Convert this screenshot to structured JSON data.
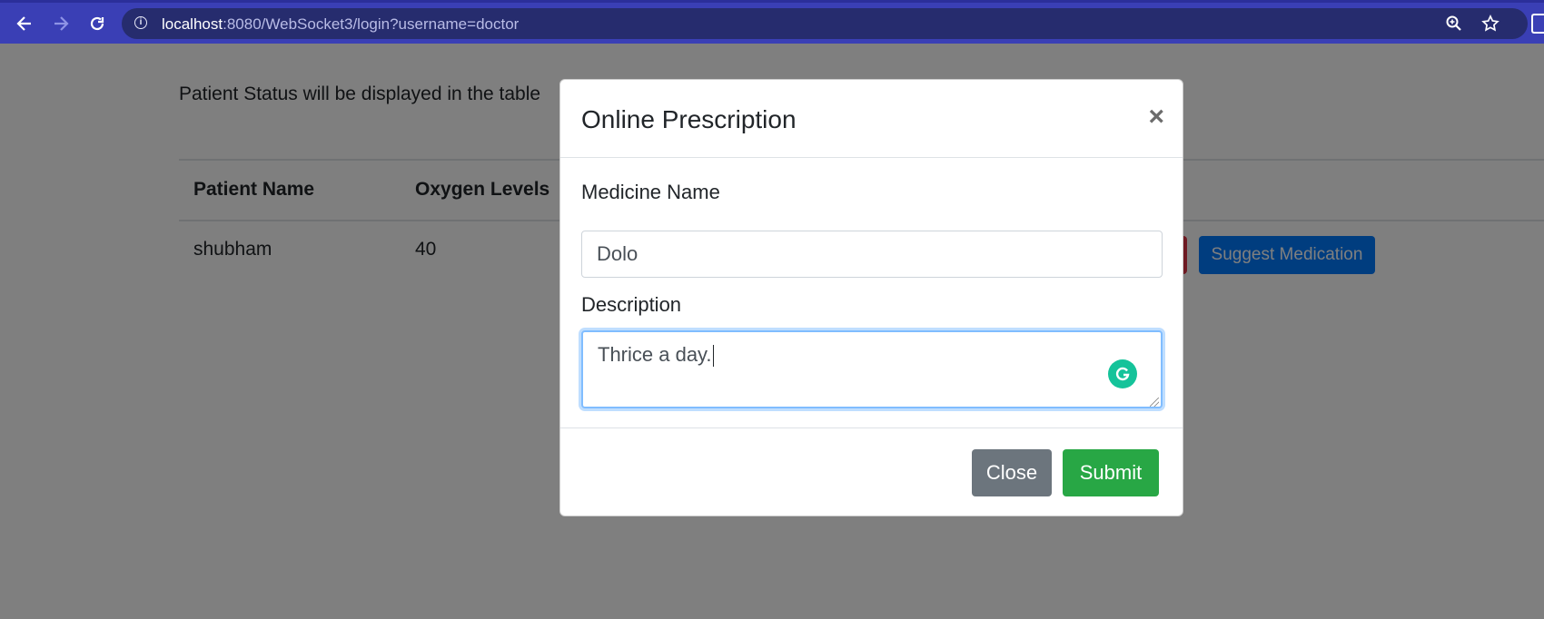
{
  "browser": {
    "url_host": "localhost",
    "url_rest": ":8080/WebSocket3/login?username=doctor"
  },
  "page": {
    "intro_text": "Patient Status will be displayed in the table",
    "table": {
      "headers": [
        "Patient Name",
        "Oxygen Levels"
      ],
      "rows": [
        {
          "patient_name": "shubham",
          "oxygen_level": "40"
        }
      ]
    },
    "suggest_button": "Suggest Medication"
  },
  "modal": {
    "title": "Online Prescription",
    "close_glyph": "×",
    "medicine_label": "Medicine Name",
    "medicine_value": "Dolo",
    "description_label": "Description",
    "description_value": "Thrice a day.",
    "close_button": "Close",
    "submit_button": "Submit"
  },
  "colors": {
    "browser_bar": "#3a3fb5",
    "submit": "#28a745",
    "close": "#6c757d",
    "primary": "#007bff",
    "grammarly": "#15c39a"
  }
}
